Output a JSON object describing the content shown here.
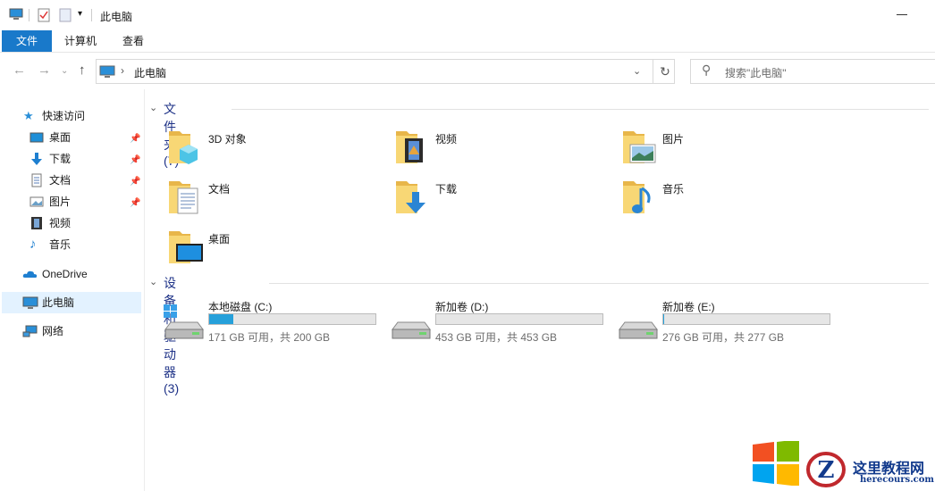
{
  "window": {
    "title": "此电脑"
  },
  "ribbon": {
    "tabs": [
      {
        "label": "文件",
        "active": true
      },
      {
        "label": "计算机"
      },
      {
        "label": "查看"
      }
    ]
  },
  "address": {
    "path": "此电脑",
    "separator": "›"
  },
  "search": {
    "placeholder": "搜索\"此电脑\""
  },
  "sidebar": {
    "quick_access": "快速访问",
    "items": [
      {
        "label": "桌面",
        "icon": "desktop-icon",
        "pinned": true
      },
      {
        "label": "下载",
        "icon": "download-icon",
        "pinned": true
      },
      {
        "label": "文档",
        "icon": "document-icon",
        "pinned": true
      },
      {
        "label": "图片",
        "icon": "picture-icon",
        "pinned": true
      },
      {
        "label": "视频",
        "icon": "video-icon",
        "pinned": false
      },
      {
        "label": "音乐",
        "icon": "music-icon",
        "pinned": false
      }
    ],
    "onedrive": "OneDrive",
    "this_pc": "此电脑",
    "network": "网络"
  },
  "folders": {
    "heading": "文件夹 (7)",
    "items": [
      {
        "name": "3D 对象",
        "icon": "3d-objects-folder-icon"
      },
      {
        "name": "视频",
        "icon": "videos-folder-icon"
      },
      {
        "name": "图片",
        "icon": "pictures-folder-icon"
      },
      {
        "name": "文档",
        "icon": "documents-folder-icon"
      },
      {
        "name": "下载",
        "icon": "downloads-folder-icon"
      },
      {
        "name": "音乐",
        "icon": "music-folder-icon"
      },
      {
        "name": "桌面",
        "icon": "desktop-folder-icon"
      }
    ]
  },
  "drives": {
    "heading": "设备和驱动器 (3)",
    "items": [
      {
        "name": "本地磁盘 (C:)",
        "info": "171 GB 可用，共 200 GB",
        "used_fraction": 0.145,
        "system": true
      },
      {
        "name": "新加卷 (D:)",
        "info": "453 GB 可用，共 453 GB",
        "used_fraction": 0.0,
        "system": false
      },
      {
        "name": "新加卷 (E:)",
        "info": "276 GB 可用，共 277 GB",
        "used_fraction": 0.004,
        "system": false
      }
    ]
  },
  "colors": {
    "accent": "#1979ca",
    "bar_fill": "#26a0da",
    "heading": "#1e3287",
    "folder": "#f8d775"
  },
  "watermark": {
    "text": "这里教程网",
    "url": "herecours.com"
  }
}
